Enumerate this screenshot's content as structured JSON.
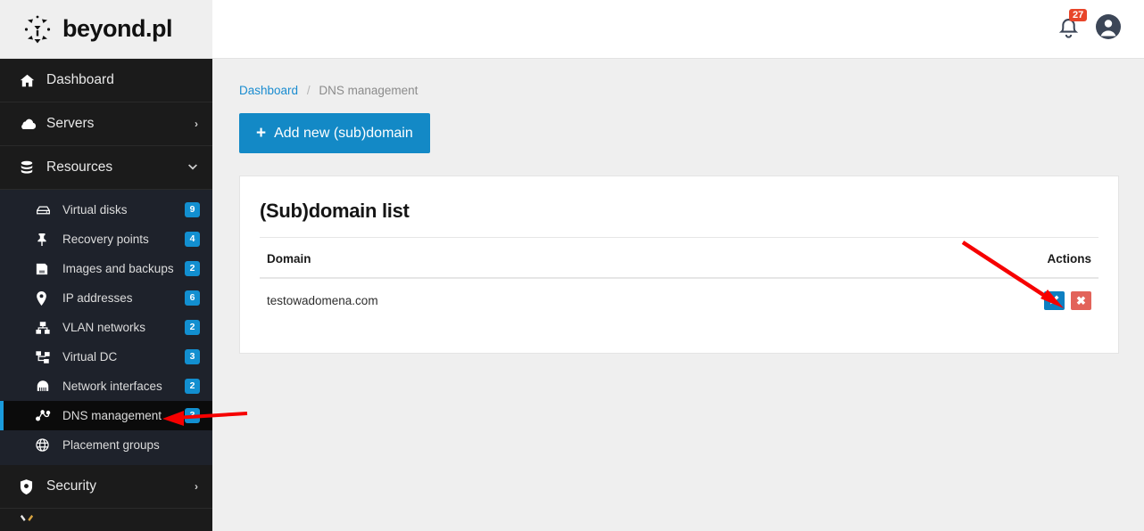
{
  "brand": {
    "name": "beyond.pl",
    "logo_icon": "beyond-logo-icon"
  },
  "topbar": {
    "bell_icon": "bell-icon",
    "notification_count": "27",
    "avatar_icon": "user-avatar-icon"
  },
  "sidebar": {
    "top_items": [
      {
        "label": "Dashboard",
        "icon": "home-icon",
        "caret": ""
      },
      {
        "label": "Servers",
        "icon": "cloud-icon",
        "caret": "›"
      },
      {
        "label": "Resources",
        "icon": "database-icon",
        "caret": "⌄"
      }
    ],
    "sub_items": [
      {
        "label": "Virtual disks",
        "icon": "hard-disk-icon",
        "badge": "9",
        "active": false
      },
      {
        "label": "Recovery points",
        "icon": "pin-icon",
        "badge": "4",
        "active": false
      },
      {
        "label": "Images and backups",
        "icon": "save-icon",
        "badge": "2",
        "active": false
      },
      {
        "label": "IP addresses",
        "icon": "map-marker-icon",
        "badge": "6",
        "active": false
      },
      {
        "label": "VLAN networks",
        "icon": "sitemap-icon",
        "badge": "2",
        "active": false
      },
      {
        "label": "Virtual DC",
        "icon": "network-tree-icon",
        "badge": "3",
        "active": false
      },
      {
        "label": "Network interfaces",
        "icon": "ethernet-port-icon",
        "badge": "2",
        "active": false
      },
      {
        "label": "DNS management",
        "icon": "dns-nodes-icon",
        "badge": "3",
        "active": true
      },
      {
        "label": "Placement groups",
        "icon": "globe-icon",
        "badge": "",
        "active": false
      }
    ],
    "bottom_items": [
      {
        "label": "Security",
        "icon": "shield-icon",
        "caret": "›"
      }
    ]
  },
  "breadcrumb": {
    "root": "Dashboard",
    "separator": "/",
    "current": "DNS management"
  },
  "toolbar": {
    "add_plus": "+",
    "add_label": "Add new (sub)domain"
  },
  "card": {
    "title": "(Sub)domain list",
    "columns": {
      "domain": "Domain",
      "actions": "Actions"
    },
    "rows": [
      {
        "domain": "testowadomena.com",
        "edit_icon": "pencil-icon",
        "delete_icon": "times-icon",
        "delete_glyph": "✖"
      }
    ]
  },
  "colors": {
    "accent_blue": "#1389c6",
    "badge_blue": "#128fd0",
    "active_border": "#1a9bdc",
    "danger_red": "#e2635a",
    "notification_red": "#e8452a",
    "sidebar_bg": "#1b1b1b",
    "submenu_bg": "#1e222b",
    "page_bg": "#efefef",
    "annotation_red": "#f60000"
  },
  "annotations": [
    {
      "name": "arrow-to-edit-button"
    },
    {
      "name": "arrow-to-dns-management"
    }
  ]
}
